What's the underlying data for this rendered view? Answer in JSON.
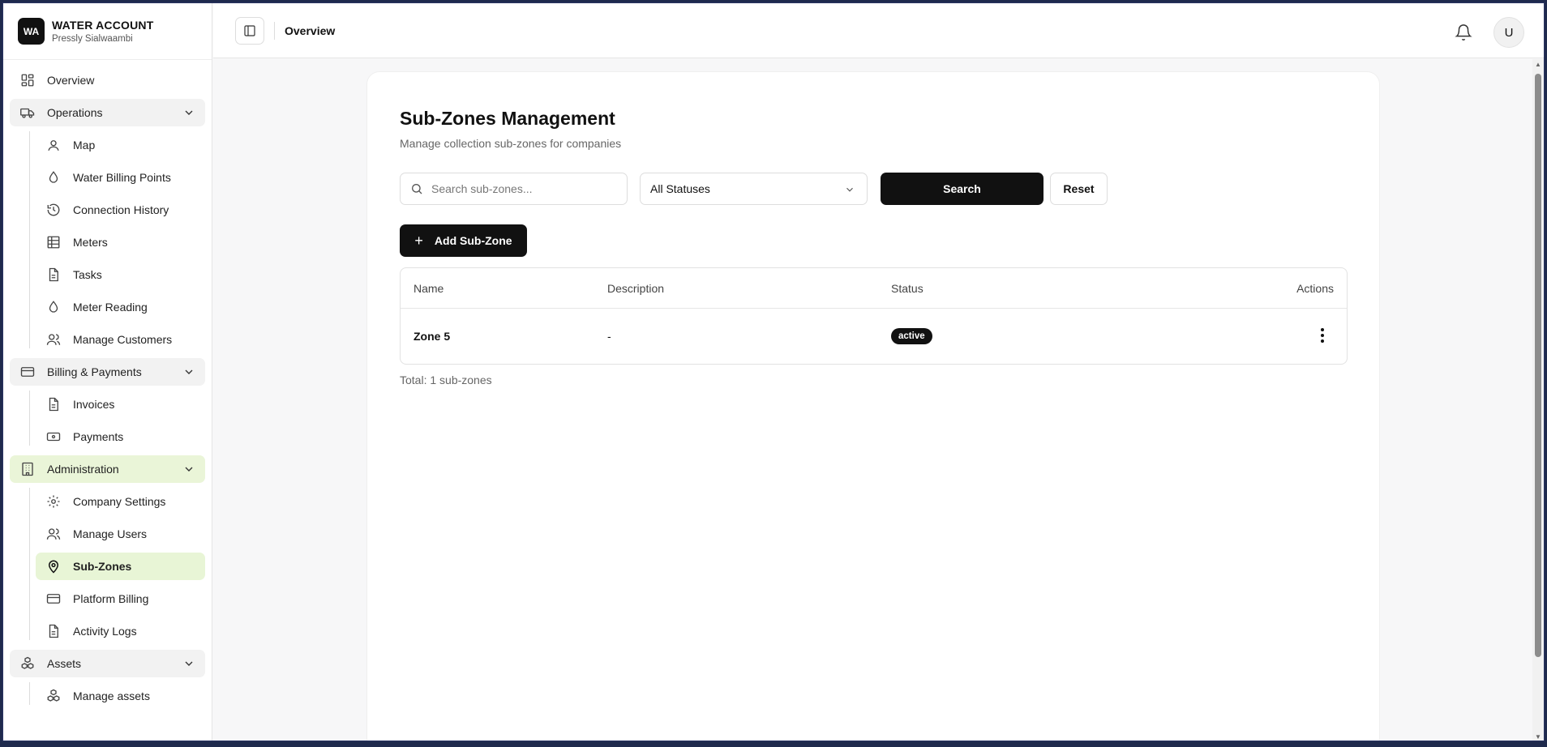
{
  "brand": {
    "logo": "WA",
    "title": "WATER ACCOUNT",
    "subtitle": "Pressly Sialwaambi"
  },
  "sidebar": {
    "overview": "Overview",
    "operations": {
      "label": "Operations",
      "items": [
        "Map",
        "Water Billing Points",
        "Connection History",
        "Meters",
        "Tasks",
        "Meter Reading",
        "Manage Customers"
      ]
    },
    "billing": {
      "label": "Billing & Payments",
      "items": [
        "Invoices",
        "Payments"
      ]
    },
    "administration": {
      "label": "Administration",
      "items": [
        "Company Settings",
        "Manage Users",
        "Sub-Zones",
        "Platform Billing",
        "Activity Logs"
      ]
    },
    "assets": {
      "label": "Assets",
      "items": [
        "Manage assets"
      ]
    }
  },
  "header": {
    "title": "Overview",
    "avatar": "U"
  },
  "main": {
    "title": "Sub-Zones Management",
    "subtitle": "Manage collection sub-zones for companies",
    "search_placeholder": "Search sub-zones...",
    "status_select": "All Statuses",
    "search_button": "Search",
    "reset_button": "Reset",
    "add_button": "Add Sub-Zone",
    "table": {
      "headers": {
        "name": "Name",
        "description": "Description",
        "status": "Status",
        "actions": "Actions"
      },
      "rows": [
        {
          "name": "Zone 5",
          "description": "-",
          "status": "active"
        }
      ]
    },
    "total": "Total: 1 sub-zones"
  },
  "colors": {
    "accent_active": "#e8f5d6",
    "primary_button": "#111111"
  }
}
